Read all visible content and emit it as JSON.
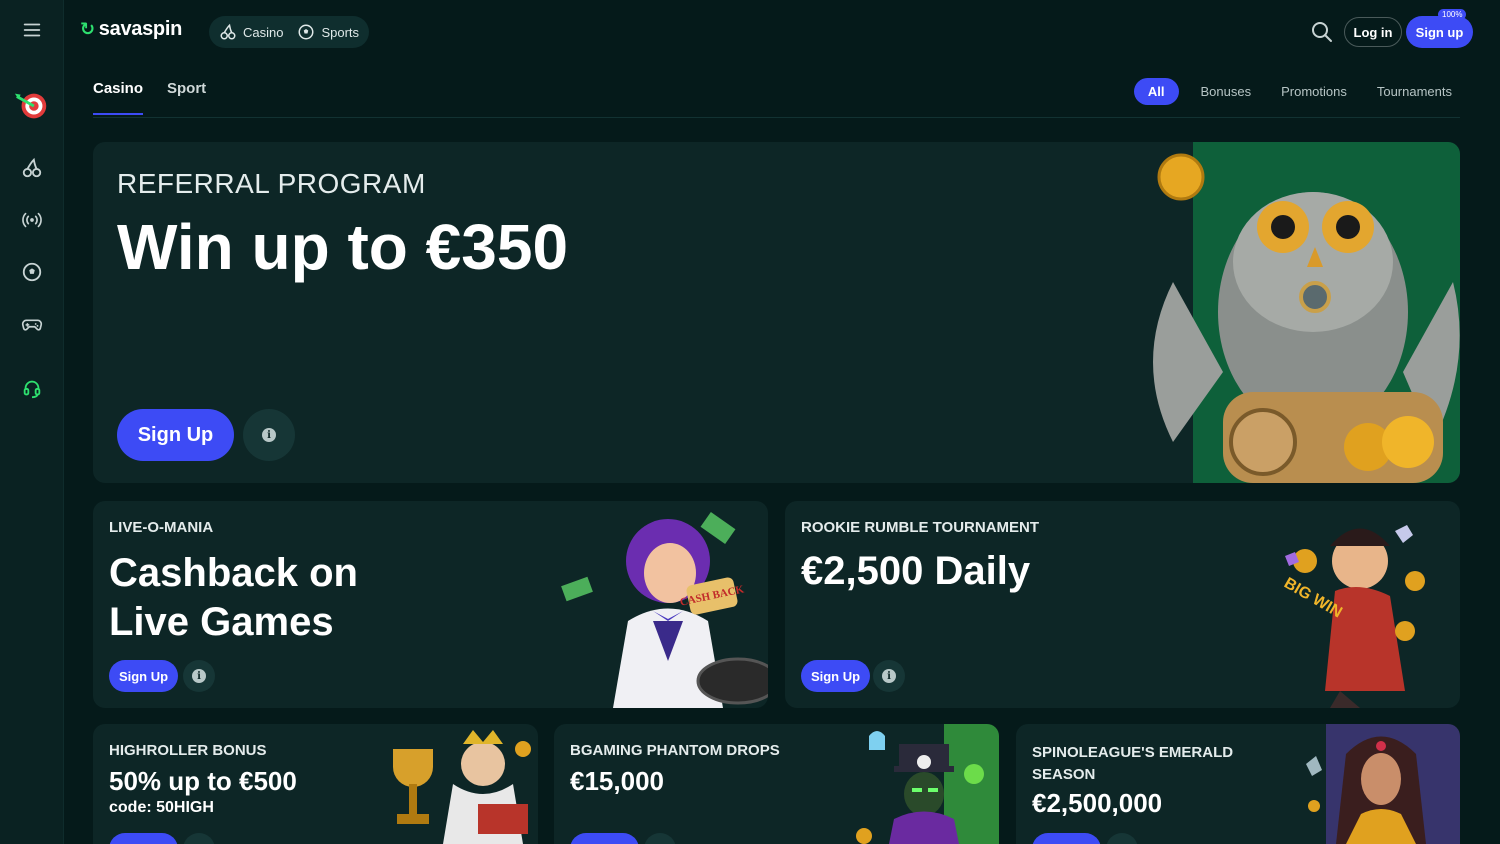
{
  "header": {
    "logo_text": "savaspin",
    "nav": [
      {
        "label": "Casino",
        "icon": "cherry-icon"
      },
      {
        "label": "Sports",
        "icon": "soccer-ball-icon"
      }
    ],
    "login_label": "Log in",
    "signup_label": "Sign up",
    "signup_badge": "100%"
  },
  "sidebar": {
    "items": [
      "menu-icon",
      "dart-target-icon",
      "cherry-icon",
      "live-broadcast-icon",
      "soccer-ball-icon",
      "gamepad-icon",
      "headset-icon"
    ]
  },
  "tabs": [
    {
      "label": "Casino",
      "active": true
    },
    {
      "label": "Sport",
      "active": false
    }
  ],
  "filters": [
    {
      "label": "All",
      "active": true
    },
    {
      "label": "Bonuses",
      "active": false
    },
    {
      "label": "Promotions",
      "active": false
    },
    {
      "label": "Tournaments",
      "active": false
    }
  ],
  "hero": {
    "eyebrow": "REFERRAL PROGRAM",
    "headline": "Win up to €350",
    "cta": "Sign Up"
  },
  "promos_row1": [
    {
      "eyebrow": "LIVE-O-MANIA",
      "headline_line1": "Cashback on",
      "headline_line2": "Live Games",
      "cta": "Sign Up",
      "art_text": "CASH BACK"
    },
    {
      "eyebrow": "ROOKIE RUMBLE TOURNAMENT",
      "headline_line1": "€2,500 Daily",
      "cta": "Sign Up",
      "art_text": "BIG WIN"
    }
  ],
  "promos_row2": [
    {
      "eyebrow_line1": "HIGHROLLER BONUS",
      "headline": "50% up to €500",
      "sub": "code: 50HIGH"
    },
    {
      "eyebrow_line1": "BGAMING PHANTOM DROPS",
      "headline": "€15,000"
    },
    {
      "eyebrow_line1": "SPINOLEAGUE'S EMERALD",
      "eyebrow_line2": "SEASON",
      "headline": "€2,500,000"
    }
  ],
  "colors": {
    "accent": "#3d4bf5",
    "brand_green": "#2ee06f",
    "bg": "#051a1a",
    "card": "#0d2626"
  }
}
